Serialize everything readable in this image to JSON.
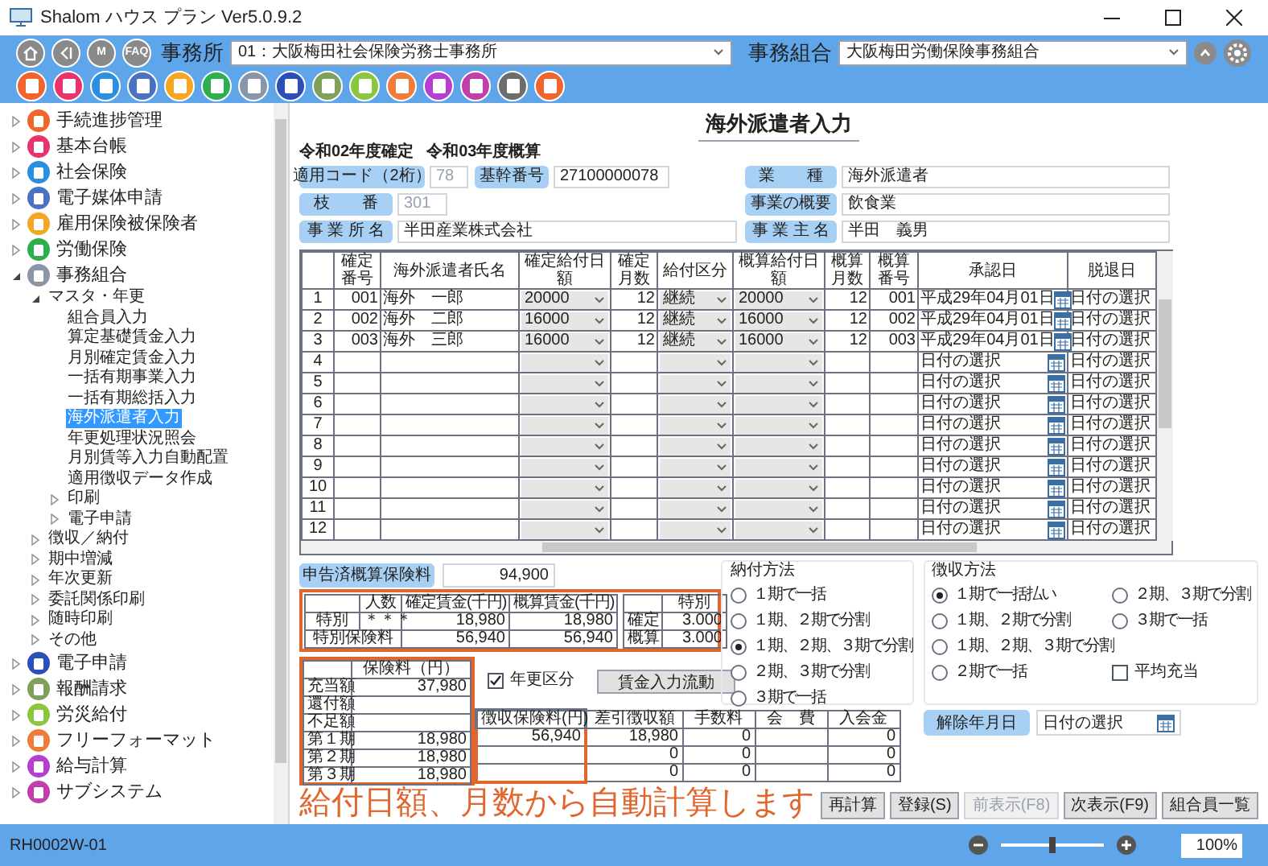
{
  "window": {
    "title": "Shalom ハウス プラン Ver5.0.9.2"
  },
  "toolbar": {
    "nav": [
      {
        "kind": "home"
      },
      {
        "kind": "back"
      },
      {
        "kind": "text",
        "label": "M"
      },
      {
        "kind": "text",
        "label": "FAQ"
      }
    ],
    "office_label": "事務所",
    "office_value": "01：大阪梅田社会保険労務士事務所",
    "union_label": "事務組合",
    "union_value": "大阪梅田労働保険事務組合"
  },
  "app_icons": [
    {
      "color": "#f0642d"
    },
    {
      "color": "#e8336d"
    },
    {
      "color": "#2b8ee0"
    },
    {
      "color": "#4a72c0"
    },
    {
      "color": "#f5a623"
    },
    {
      "color": "#2eae4f"
    },
    {
      "color": "#8a96a8"
    },
    {
      "color": "#2b4fb8"
    },
    {
      "color": "#7fa05a"
    },
    {
      "color": "#8cc63f"
    },
    {
      "color": "#f07c3a"
    },
    {
      "color": "#b43fd1"
    },
    {
      "color": "#c03fa8"
    },
    {
      "color": "#6d6d6d"
    },
    {
      "color": "#f0642e"
    }
  ],
  "sidebar": {
    "items": [
      {
        "label": "手続進捗管理",
        "color": "#f0642d",
        "expanded": false,
        "selected": false
      },
      {
        "label": "基本台帳",
        "color": "#e8336d",
        "expanded": false,
        "selected": false
      },
      {
        "label": "社会保険",
        "color": "#2b8ee0",
        "expanded": false,
        "selected": false
      },
      {
        "label": "電子媒体申請",
        "color": "#4a72c0",
        "expanded": false,
        "selected": false
      },
      {
        "label": "雇用保険被保険者",
        "color": "#f5a623",
        "expanded": false,
        "selected": false
      },
      {
        "label": "労働保険",
        "color": "#2eae4f",
        "expanded": false,
        "selected": false
      },
      {
        "label": "事務組合",
        "color": "#8a96a8",
        "expanded": true,
        "selected": false,
        "children": [
          {
            "label": "マスタ・年更",
            "expanded": true,
            "selected": false,
            "children": [
              {
                "label": "組合員入力",
                "selected": false
              },
              {
                "label": "算定基礎賃金入力",
                "selected": false
              },
              {
                "label": "月別確定賃金入力",
                "selected": false
              },
              {
                "label": "一括有期事業入力",
                "selected": false
              },
              {
                "label": "一括有期総括入力",
                "selected": false
              },
              {
                "label": "海外派遣者入力",
                "selected": true
              },
              {
                "label": "年更処理状況照会",
                "selected": false
              },
              {
                "label": "月別賃等入力自動配置",
                "selected": false
              },
              {
                "label": "適用徴収データ作成",
                "selected": false
              },
              {
                "label": "印刷",
                "expanded": false,
                "selected": false
              },
              {
                "label": "電子申請",
                "expanded": false,
                "selected": false
              }
            ]
          },
          {
            "label": "徴収／納付",
            "expanded": false,
            "selected": false
          },
          {
            "label": "期中増減",
            "expanded": false,
            "selected": false
          },
          {
            "label": "年次更新",
            "expanded": false,
            "selected": false
          },
          {
            "label": "委託関係印刷",
            "expanded": false,
            "selected": false
          },
          {
            "label": "随時印刷",
            "expanded": false,
            "selected": false
          },
          {
            "label": "その他",
            "expanded": false,
            "selected": false
          }
        ]
      },
      {
        "label": "電子申請",
        "color": "#2b4fb8",
        "expanded": false,
        "selected": false
      },
      {
        "label": "報酬請求",
        "color": "#7fa05a",
        "expanded": false,
        "selected": false
      },
      {
        "label": "労災給付",
        "color": "#8cc63f",
        "expanded": false,
        "selected": false
      },
      {
        "label": "フリーフォーマット",
        "color": "#f07c3a",
        "expanded": false,
        "selected": false
      },
      {
        "label": "給与計算",
        "color": "#b43fd1",
        "expanded": false,
        "selected": false
      },
      {
        "label": "サブシステム",
        "color": "#c03fa8",
        "expanded": false,
        "selected": false
      }
    ]
  },
  "form": {
    "title": "海外派遣者入力",
    "periods": [
      "令和02年度確定",
      "令和03年度概算"
    ],
    "apply_code": {
      "label": "適用コード（2桁）",
      "value": "78",
      "disabled": true
    },
    "base_number": {
      "label": "基幹番号",
      "value": "27100000078",
      "disabled": false
    },
    "branch": {
      "label": "枝　　番",
      "value": "301",
      "disabled": true
    },
    "office_name": {
      "label": "事 業 所 名",
      "value": "半田産業株式会社",
      "disabled": false
    },
    "industry": {
      "label": "業　　種",
      "value": "海外派遣者",
      "disabled": false
    },
    "business_summary": {
      "label": "事業の概要",
      "value": "飲食業",
      "disabled": false
    },
    "owner": {
      "label": "事 業 主 名",
      "value": "半田　義男",
      "disabled": false
    }
  },
  "table": {
    "columns": [
      "確定番号",
      "海外派遣者氏名",
      "確定給付日額",
      "確定月数",
      "給付区分",
      "概算給付日額",
      "概算月数",
      "概算番号",
      "承認日",
      "脱退日"
    ],
    "rows": [
      {
        "no": "1",
        "code": "001",
        "name": "海外　一郎",
        "daily": "20000",
        "months": "12",
        "category": "継続",
        "est_daily": "20000",
        "est_months": "12",
        "est_code": "001",
        "approved": "平成29年04月01日",
        "withdrawn": "日付の選択"
      },
      {
        "no": "2",
        "code": "002",
        "name": "海外　二郎",
        "daily": "16000",
        "months": "12",
        "category": "継続",
        "est_daily": "16000",
        "est_months": "12",
        "est_code": "002",
        "approved": "平成29年04月01日",
        "withdrawn": "日付の選択"
      },
      {
        "no": "3",
        "code": "003",
        "name": "海外　三郎",
        "daily": "16000",
        "months": "12",
        "category": "継続",
        "est_daily": "16000",
        "est_months": "12",
        "est_code": "003",
        "approved": "平成29年04月01日",
        "withdrawn": "日付の選択"
      },
      {
        "no": "4",
        "approved": "日付の選択",
        "withdrawn": "日付の選択"
      },
      {
        "no": "5",
        "approved": "日付の選択",
        "withdrawn": "日付の選択"
      },
      {
        "no": "6",
        "approved": "日付の選択",
        "withdrawn": "日付の選択"
      },
      {
        "no": "7",
        "approved": "日付の選択",
        "withdrawn": "日付の選択"
      },
      {
        "no": "8",
        "approved": "日付の選択",
        "withdrawn": "日付の選択"
      },
      {
        "no": "9",
        "approved": "日付の選択",
        "withdrawn": "日付の選択"
      },
      {
        "no": "10",
        "approved": "日付の選択",
        "withdrawn": "日付の選択"
      },
      {
        "no": "11",
        "approved": "日付の選択",
        "withdrawn": "日付の選択"
      },
      {
        "no": "12",
        "approved": "日付の選択",
        "withdrawn": "日付の選択"
      }
    ]
  },
  "declared": {
    "label": "申告済概算保険料",
    "value": "94,900"
  },
  "wage_table": {
    "columns": [
      "人数",
      "確定賃金(千円)",
      "概算賃金(千円)"
    ],
    "rows": [
      {
        "label": "特別",
        "count": "＊＊＊",
        "confirmed": "18,980",
        "estimated": "18,980"
      },
      {
        "label": "特別保険料",
        "confirmed": "56,940",
        "estimated": "56,940"
      }
    ]
  },
  "rate_table": {
    "column": "特別",
    "rows": [
      {
        "label": "確定",
        "value": "3.000"
      },
      {
        "label": "概算",
        "value": "3.000"
      }
    ]
  },
  "premium_table": {
    "column": "保険料（円）",
    "rows": [
      {
        "label": "充当額",
        "value": "37,980"
      },
      {
        "label": "還付額"
      },
      {
        "label": "不足額"
      },
      {
        "label": "第１期",
        "value": "18,980"
      },
      {
        "label": "第２期",
        "value": "18,980"
      },
      {
        "label": "第３期",
        "value": "18,980"
      }
    ]
  },
  "renewal": {
    "label": "年更区分",
    "checked": true
  },
  "wage_flow_button": "賃金入力流動",
  "collection_table": {
    "columns": [
      "徴収保険料(円)",
      "差引徴収額",
      "手数料",
      "会　費",
      "入会金"
    ],
    "rows": [
      {
        "premium": "56,940",
        "net": "18,980",
        "fee": "0",
        "entry": "0"
      },
      {
        "net": "0",
        "fee": "0",
        "entry": "0"
      },
      {
        "net": "0",
        "fee": "0",
        "entry": "0"
      }
    ]
  },
  "payment_method": {
    "title": "納付方法",
    "options": [
      {
        "label": "１期で一括",
        "selected": false
      },
      {
        "label": "１期、２期で分割",
        "selected": false
      },
      {
        "label": "１期、２期、３期で分割",
        "selected": true
      },
      {
        "label": "２期、３期で分割",
        "selected": false
      },
      {
        "label": "３期で一括",
        "selected": false
      }
    ]
  },
  "collection_method": {
    "title": "徴収方法",
    "options": [
      {
        "label": "１期で一括払い",
        "selected": true
      },
      {
        "label": "１期、２期で分割",
        "selected": false
      },
      {
        "label": "１期、２期、３期で分割",
        "selected": false
      },
      {
        "label": "２期で一括",
        "selected": false
      },
      {
        "label": "２期、３期で分割",
        "selected": false
      },
      {
        "label": "３期で一括",
        "selected": false
      }
    ],
    "average": {
      "label": "平均充当",
      "checked": false
    }
  },
  "cancel_date": {
    "label": "解除年月日",
    "value": "日付の選択"
  },
  "annotation": "給付日額、月数から自動計算します",
  "buttons": [
    {
      "label": "再計算",
      "disabled": false
    },
    {
      "label": "登録(S)",
      "disabled": false
    },
    {
      "label": "前表示(F8)",
      "disabled": true
    },
    {
      "label": "次表示(F9)",
      "disabled": false
    },
    {
      "label": "組合員一覧",
      "disabled": false
    }
  ],
  "status_bar": {
    "code": "RH0002W-01",
    "zoom": {
      "level": 0.5,
      "value": "100%"
    }
  }
}
